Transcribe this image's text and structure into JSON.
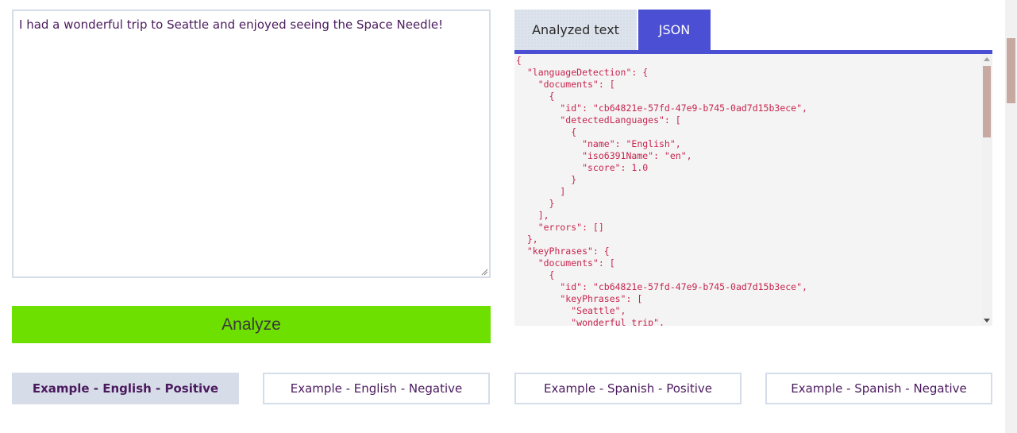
{
  "input": {
    "text": "I had a wonderful trip to Seattle and enjoyed seeing the Space Needle!"
  },
  "analyze_button": {
    "label": "Analyze"
  },
  "tabs": [
    {
      "label": "Analyzed text",
      "active": false
    },
    {
      "label": "JSON",
      "active": true
    }
  ],
  "json_output": {
    "text": "{\n  \"languageDetection\": {\n    \"documents\": [\n      {\n        \"id\": \"cb64821e-57fd-47e9-b745-0ad7d15b3ece\",\n        \"detectedLanguages\": [\n          {\n            \"name\": \"English\",\n            \"iso6391Name\": \"en\",\n            \"score\": 1.0\n          }\n        ]\n      }\n    ],\n    \"errors\": []\n  },\n  \"keyPhrases\": {\n    \"documents\": [\n      {\n        \"id\": \"cb64821e-57fd-47e9-b745-0ad7d15b3ece\",\n        \"keyPhrases\": [\n          \"Seattle\",\n          \"wonderful trip\","
  },
  "examples": [
    {
      "label": "Example - English - Positive",
      "active": true
    },
    {
      "label": "Example - English - Negative",
      "active": false
    },
    {
      "label": "Example - Spanish - Positive",
      "active": false
    },
    {
      "label": "Example - Spanish - Negative",
      "active": false
    }
  ],
  "colors": {
    "accent": "#4b4fd4",
    "analyze_button": "#6ee000",
    "json_text": "#c7254e",
    "text_purple": "#4b1a5e"
  }
}
